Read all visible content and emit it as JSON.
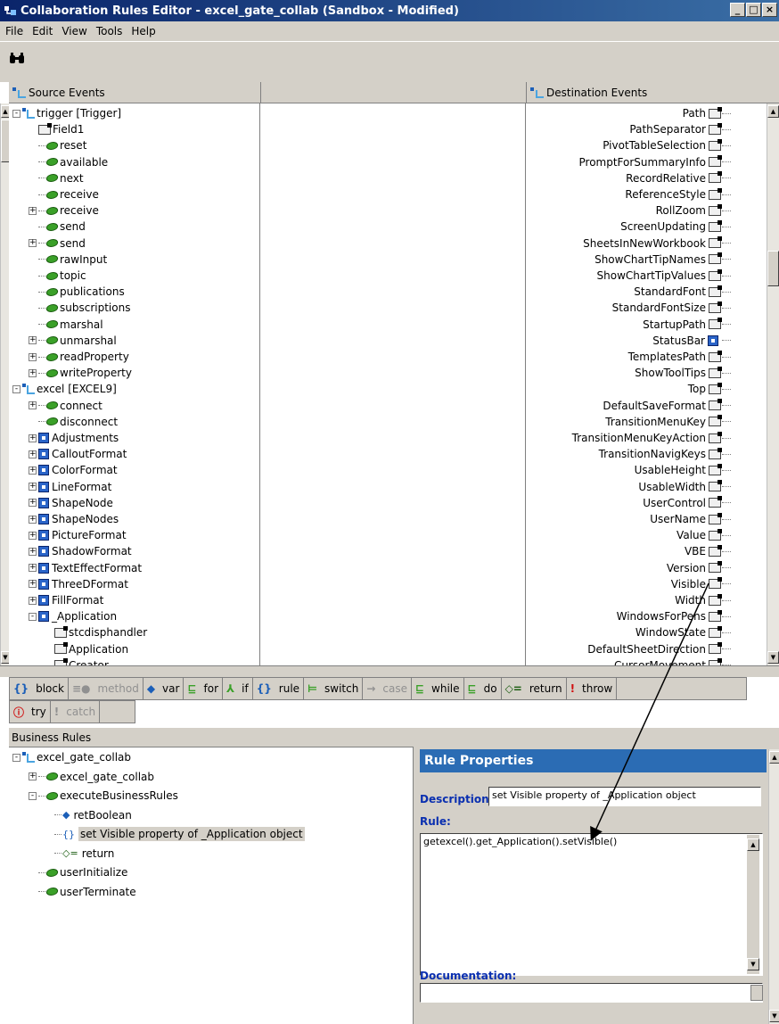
{
  "window": {
    "title": "Collaboration Rules Editor - excel_gate_collab (Sandbox - Modified)",
    "buttons": [
      "_",
      "□",
      "×"
    ]
  },
  "menu": [
    "File",
    "Edit",
    "View",
    "Tools",
    "Help"
  ],
  "source": {
    "header": "Source Events",
    "items": [
      {
        "label": "trigger [Trigger]",
        "depth": 0,
        "exp": "-",
        "icon": "trigger"
      },
      {
        "label": "Field1",
        "depth": 1,
        "exp": "",
        "icon": "prop"
      },
      {
        "label": "reset",
        "depth": 1,
        "exp": "",
        "icon": "method"
      },
      {
        "label": "available",
        "depth": 1,
        "exp": "",
        "icon": "method"
      },
      {
        "label": "next",
        "depth": 1,
        "exp": "",
        "icon": "method"
      },
      {
        "label": "receive",
        "depth": 1,
        "exp": "",
        "icon": "method"
      },
      {
        "label": "receive",
        "depth": 1,
        "exp": "+",
        "icon": "method"
      },
      {
        "label": "send",
        "depth": 1,
        "exp": "",
        "icon": "method"
      },
      {
        "label": "send",
        "depth": 1,
        "exp": "+",
        "icon": "method"
      },
      {
        "label": "rawInput",
        "depth": 1,
        "exp": "",
        "icon": "method"
      },
      {
        "label": "topic",
        "depth": 1,
        "exp": "",
        "icon": "method"
      },
      {
        "label": "publications",
        "depth": 1,
        "exp": "",
        "icon": "method"
      },
      {
        "label": "subscriptions",
        "depth": 1,
        "exp": "",
        "icon": "method"
      },
      {
        "label": "marshal",
        "depth": 1,
        "exp": "",
        "icon": "method"
      },
      {
        "label": "unmarshal",
        "depth": 1,
        "exp": "+",
        "icon": "method"
      },
      {
        "label": "readProperty",
        "depth": 1,
        "exp": "+",
        "icon": "method"
      },
      {
        "label": "writeProperty",
        "depth": 1,
        "exp": "+",
        "icon": "method"
      },
      {
        "label": "excel [EXCEL9]",
        "depth": 0,
        "exp": "-",
        "icon": "trigger"
      },
      {
        "label": "connect",
        "depth": 1,
        "exp": "+",
        "icon": "method"
      },
      {
        "label": "disconnect",
        "depth": 1,
        "exp": "",
        "icon": "method"
      },
      {
        "label": "Adjustments",
        "depth": 1,
        "exp": "+",
        "icon": "class"
      },
      {
        "label": "CalloutFormat",
        "depth": 1,
        "exp": "+",
        "icon": "class"
      },
      {
        "label": "ColorFormat",
        "depth": 1,
        "exp": "+",
        "icon": "class"
      },
      {
        "label": "LineFormat",
        "depth": 1,
        "exp": "+",
        "icon": "class"
      },
      {
        "label": "ShapeNode",
        "depth": 1,
        "exp": "+",
        "icon": "class"
      },
      {
        "label": "ShapeNodes",
        "depth": 1,
        "exp": "+",
        "icon": "class"
      },
      {
        "label": "PictureFormat",
        "depth": 1,
        "exp": "+",
        "icon": "class"
      },
      {
        "label": "ShadowFormat",
        "depth": 1,
        "exp": "+",
        "icon": "class"
      },
      {
        "label": "TextEffectFormat",
        "depth": 1,
        "exp": "+",
        "icon": "class"
      },
      {
        "label": "ThreeDFormat",
        "depth": 1,
        "exp": "+",
        "icon": "class"
      },
      {
        "label": "FillFormat",
        "depth": 1,
        "exp": "+",
        "icon": "class"
      },
      {
        "label": "_Application",
        "depth": 1,
        "exp": "-",
        "icon": "class"
      },
      {
        "label": "stcdisphandler",
        "depth": 2,
        "exp": "",
        "icon": "prop"
      },
      {
        "label": "Application",
        "depth": 2,
        "exp": "",
        "icon": "prop"
      },
      {
        "label": "Creator",
        "depth": 2,
        "exp": "",
        "icon": "prop"
      }
    ]
  },
  "destination": {
    "header": "Destination Events",
    "items": [
      "Path",
      "PathSeparator",
      "PivotTableSelection",
      "PromptForSummaryInfo",
      "RecordRelative",
      "ReferenceStyle",
      "RollZoom",
      "ScreenUpdating",
      "SheetsInNewWorkbook",
      "ShowChartTipNames",
      "ShowChartTipValues",
      "StandardFont",
      "StandardFontSize",
      "StartupPath",
      "StatusBar",
      "TemplatesPath",
      "ShowToolTips",
      "Top",
      "DefaultSaveFormat",
      "TransitionMenuKey",
      "TransitionMenuKeyAction",
      "TransitionNavigKeys",
      "UsableHeight",
      "UsableWidth",
      "UserControl",
      "UserName",
      "Value",
      "VBE",
      "Version",
      "Visible",
      "Width",
      "WindowsForPens",
      "WindowState",
      "DefaultSheetDirection",
      "CursorMovement"
    ]
  },
  "toolbar": [
    {
      "icon": "{}",
      "label": "block",
      "disabled": false,
      "color": "#1c5fb8"
    },
    {
      "icon": "≡●",
      "label": "method",
      "disabled": true,
      "color": "#909090"
    },
    {
      "icon": "◆",
      "label": "var",
      "disabled": false,
      "color": "#1c5fb8"
    },
    {
      "icon": "⊑",
      "label": "for",
      "disabled": false,
      "color": "#3aa028"
    },
    {
      "icon": "⅄",
      "label": "if",
      "disabled": false,
      "color": "#3aa028"
    },
    {
      "icon": "{}",
      "label": "rule",
      "disabled": false,
      "color": "#1c5fb8"
    },
    {
      "icon": "⊨",
      "label": "switch",
      "disabled": false,
      "color": "#3aa028"
    },
    {
      "icon": "→",
      "label": "case",
      "disabled": true,
      "color": "#909090"
    },
    {
      "icon": "⊑",
      "label": "while",
      "disabled": false,
      "color": "#3aa028"
    },
    {
      "icon": "⊑",
      "label": "do",
      "disabled": false,
      "color": "#3aa028"
    },
    {
      "icon": "◇=",
      "label": "return",
      "disabled": false,
      "color": "#1a5c10"
    },
    {
      "icon": "!",
      "label": "throw",
      "disabled": false,
      "color": "#d01010"
    }
  ],
  "toolbar2": [
    {
      "icon": "ⓘ",
      "label": "try",
      "disabled": false,
      "color": "#d01010"
    },
    {
      "icon": "!",
      "label": "catch",
      "disabled": true,
      "color": "#909090"
    }
  ],
  "business_rules": {
    "header": "Business Rules",
    "items": [
      {
        "label": "excel_gate_collab",
        "depth": 0,
        "exp": "-",
        "icon": "trigger"
      },
      {
        "label": "excel_gate_collab",
        "depth": 1,
        "exp": "+",
        "icon": "method"
      },
      {
        "label": "executeBusinessRules",
        "depth": 1,
        "exp": "-",
        "icon": "method"
      },
      {
        "label": "retBoolean",
        "depth": 2,
        "exp": "",
        "icon": "var"
      },
      {
        "label": "set Visible property of _Application object",
        "depth": 2,
        "exp": "",
        "icon": "rule",
        "selected": true
      },
      {
        "label": "return",
        "depth": 2,
        "exp": "",
        "icon": "return"
      },
      {
        "label": "userInitialize",
        "depth": 1,
        "exp": "",
        "icon": "method"
      },
      {
        "label": "userTerminate",
        "depth": 1,
        "exp": "",
        "icon": "method"
      }
    ]
  },
  "rule_properties": {
    "header": "Rule Properties",
    "description_label": "Description:",
    "description_value": "set Visible property of _Application object",
    "rule_label": "Rule:",
    "rule_value": "getexcel().get_Application().setVisible()",
    "documentation_label": "Documentation:",
    "documentation_value": ""
  }
}
